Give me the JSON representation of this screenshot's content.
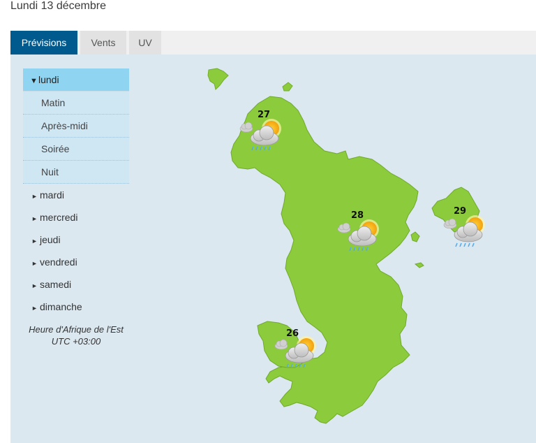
{
  "page_title": "Lundi 13 décembre",
  "tabs": [
    {
      "label": "Prévisions",
      "active": true
    },
    {
      "label": "Vents",
      "active": false
    },
    {
      "label": "UV",
      "active": false
    }
  ],
  "sidebar": {
    "open_day": "lundi",
    "slots": [
      "Matin",
      "Après-midi",
      "Soirée",
      "Nuit"
    ],
    "other_days": [
      "mardi",
      "mercredi",
      "jeudi",
      "vendredi",
      "samedi",
      "dimanche"
    ],
    "timezone_line1": "Heure d'Afrique de l'Est",
    "timezone_line2": "UTC +03:00"
  },
  "forecasts": [
    {
      "location": "north",
      "temperature": "27",
      "icon": "sun-cloud-rain-icon"
    },
    {
      "location": "center",
      "temperature": "28",
      "icon": "sun-cloud-rain-icon"
    },
    {
      "location": "east",
      "temperature": "29",
      "icon": "sun-cloud-rain-icon"
    },
    {
      "location": "south",
      "temperature": "26",
      "icon": "sun-cloud-rain-icon"
    }
  ],
  "colors": {
    "tab_active": "#005a8e",
    "land": "#8ccc3c",
    "sea": "#dce8f0",
    "sidebar_open": "#8fd5f2"
  }
}
